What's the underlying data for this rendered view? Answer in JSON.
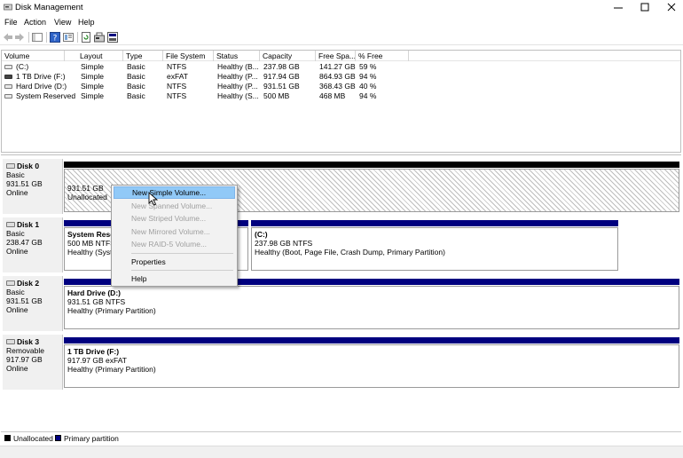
{
  "window": {
    "title": "Disk Management",
    "controls": {
      "minimize": "minimize",
      "maximize": "maximize",
      "close": "close"
    }
  },
  "menu": [
    "File",
    "Action",
    "View",
    "Help"
  ],
  "toolbar": {
    "icons": [
      "back-arrow-icon",
      "forward-arrow-icon",
      "console-tree-icon",
      "help-icon",
      "properties-icon",
      "refresh-icon",
      "rescan-icon",
      "disk-settings-icon"
    ]
  },
  "volume_list": {
    "columns": [
      "Volume",
      "Layout",
      "Type",
      "File System",
      "Status",
      "Capacity",
      "Free Spa...",
      "% Free"
    ],
    "rows": [
      {
        "volume": "(C:)",
        "layout": "Simple",
        "type": "Basic",
        "fs": "NTFS",
        "status": "Healthy (B...",
        "capacity": "237.98 GB",
        "free": "141.27 GB",
        "pct": "59 %",
        "icon": "drive-icon"
      },
      {
        "volume": "1 TB Drive (F:)",
        "layout": "Simple",
        "type": "Basic",
        "fs": "exFAT",
        "status": "Healthy (P...",
        "capacity": "917.94 GB",
        "free": "864.93 GB",
        "pct": "94 %",
        "icon": "removable-drive-icon"
      },
      {
        "volume": "Hard Drive  (D:)",
        "layout": "Simple",
        "type": "Basic",
        "fs": "NTFS",
        "status": "Healthy (P...",
        "capacity": "931.51 GB",
        "free": "368.43 GB",
        "pct": "40 %",
        "icon": "drive-icon"
      },
      {
        "volume": "System Reserved",
        "layout": "Simple",
        "type": "Basic",
        "fs": "NTFS",
        "status": "Healthy (S...",
        "capacity": "500 MB",
        "free": "468 MB",
        "pct": "94 %",
        "icon": "drive-icon"
      }
    ]
  },
  "disks": [
    {
      "name": "Disk 0",
      "type": "Basic",
      "size": "931.51 GB",
      "state": "Online",
      "partitions": [
        {
          "size_line": "931.51 GB",
          "status_line": "Unallocated",
          "kind": "unallocated"
        }
      ]
    },
    {
      "name": "Disk 1",
      "type": "Basic",
      "size": "238.47 GB",
      "state": "Online",
      "partitions": [
        {
          "title": "System Rese",
          "size_line": "500 MB NTFS",
          "status_line": "Healthy (Syste",
          "kind": "primary"
        },
        {
          "title": "(C:)",
          "size_line": "237.98 GB NTFS",
          "status_line": "Healthy (Boot, Page File, Crash Dump, Primary Partition)",
          "kind": "primary"
        }
      ]
    },
    {
      "name": "Disk 2",
      "type": "Basic",
      "size": "931.51 GB",
      "state": "Online",
      "partitions": [
        {
          "title": "Hard Drive  (D:)",
          "size_line": "931.51 GB NTFS",
          "status_line": "Healthy (Primary Partition)",
          "kind": "primary"
        }
      ]
    },
    {
      "name": "Disk 3",
      "type": "Removable",
      "size": "917.97 GB",
      "state": "Online",
      "partitions": [
        {
          "title": "1 TB Drive  (F:)",
          "size_line": "917.97 GB exFAT",
          "status_line": "Healthy (Primary Partition)",
          "kind": "primary"
        }
      ]
    }
  ],
  "legend": [
    {
      "label": "Unallocated",
      "color": "#000000"
    },
    {
      "label": "Primary partition",
      "color": "#00007f"
    }
  ],
  "context_menu": {
    "items": [
      {
        "label": "New Simple Volume...",
        "enabled": true,
        "highlighted": true
      },
      {
        "label": "New Spanned Volume...",
        "enabled": false
      },
      {
        "label": "New Striped Volume...",
        "enabled": false
      },
      {
        "label": "New Mirrored Volume...",
        "enabled": false
      },
      {
        "label": "New RAID-5 Volume...",
        "enabled": false
      },
      {
        "label": "Properties",
        "enabled": true
      },
      {
        "label": "Help",
        "enabled": true
      }
    ]
  },
  "colors": {
    "primary_partition": "#00007f",
    "unallocated": "#000000",
    "menu_highlight": "#91c9f7"
  }
}
